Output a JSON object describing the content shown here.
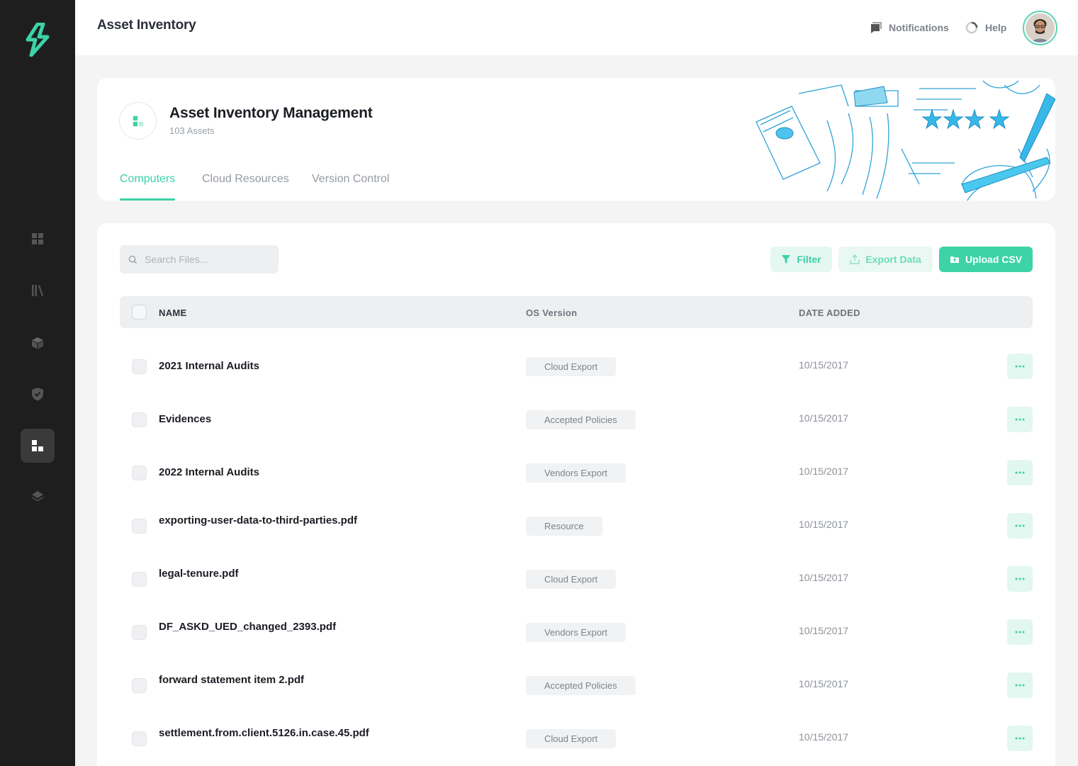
{
  "header": {
    "title": "Asset Inventory",
    "notifications_label": "Notifications",
    "help_label": "Help"
  },
  "sidebar": {
    "items": [
      {
        "icon": "dashboard-icon"
      },
      {
        "icon": "library-icon"
      },
      {
        "icon": "cube-icon"
      },
      {
        "icon": "shield-icon"
      },
      {
        "icon": "inventory-icon",
        "active": true
      },
      {
        "icon": "layers-icon"
      }
    ]
  },
  "page": {
    "title": "Asset Inventory Management",
    "subtitle": "103 Assets",
    "tabs": [
      {
        "label": "Computers",
        "active": true
      },
      {
        "label": "Cloud Resources"
      },
      {
        "label": "Version Control"
      }
    ]
  },
  "toolbar": {
    "search_placeholder": "Search Files...",
    "filter_label": "Filter",
    "export_label": "Export Data",
    "upload_label": "Upload CSV"
  },
  "table": {
    "columns": [
      "NAME",
      "OS Version",
      "DATE ADDED"
    ],
    "rows": [
      {
        "name": "2021 Internal Audits",
        "tag": "Cloud Export",
        "date": "10/15/2017"
      },
      {
        "name": "Evidences",
        "tag": "Accepted Policies",
        "date": "10/15/2017"
      },
      {
        "name": "2022 Internal Audits",
        "tag": "Vendors Export",
        "date": "10/15/2017"
      },
      {
        "name": "exporting-user-data-to-third-parties.pdf",
        "tag": "Resource",
        "date": "10/15/2017"
      },
      {
        "name": "legal-tenure.pdf",
        "tag": "Cloud Export",
        "date": "10/15/2017"
      },
      {
        "name": "DF_ASKD_UED_changed_2393.pdf",
        "tag": "Vendors Export",
        "date": "10/15/2017"
      },
      {
        "name": "forward statement item 2.pdf",
        "tag": "Accepted Policies",
        "date": "10/15/2017"
      },
      {
        "name": "settlement.from.client.5126.in.case.45.pdf",
        "tag": "Cloud Export",
        "date": "10/15/2017"
      }
    ]
  },
  "colors": {
    "accent": "#3dd3a7",
    "sidebar_bg": "#1e1e1e",
    "page_bg": "#f4f4f4"
  }
}
